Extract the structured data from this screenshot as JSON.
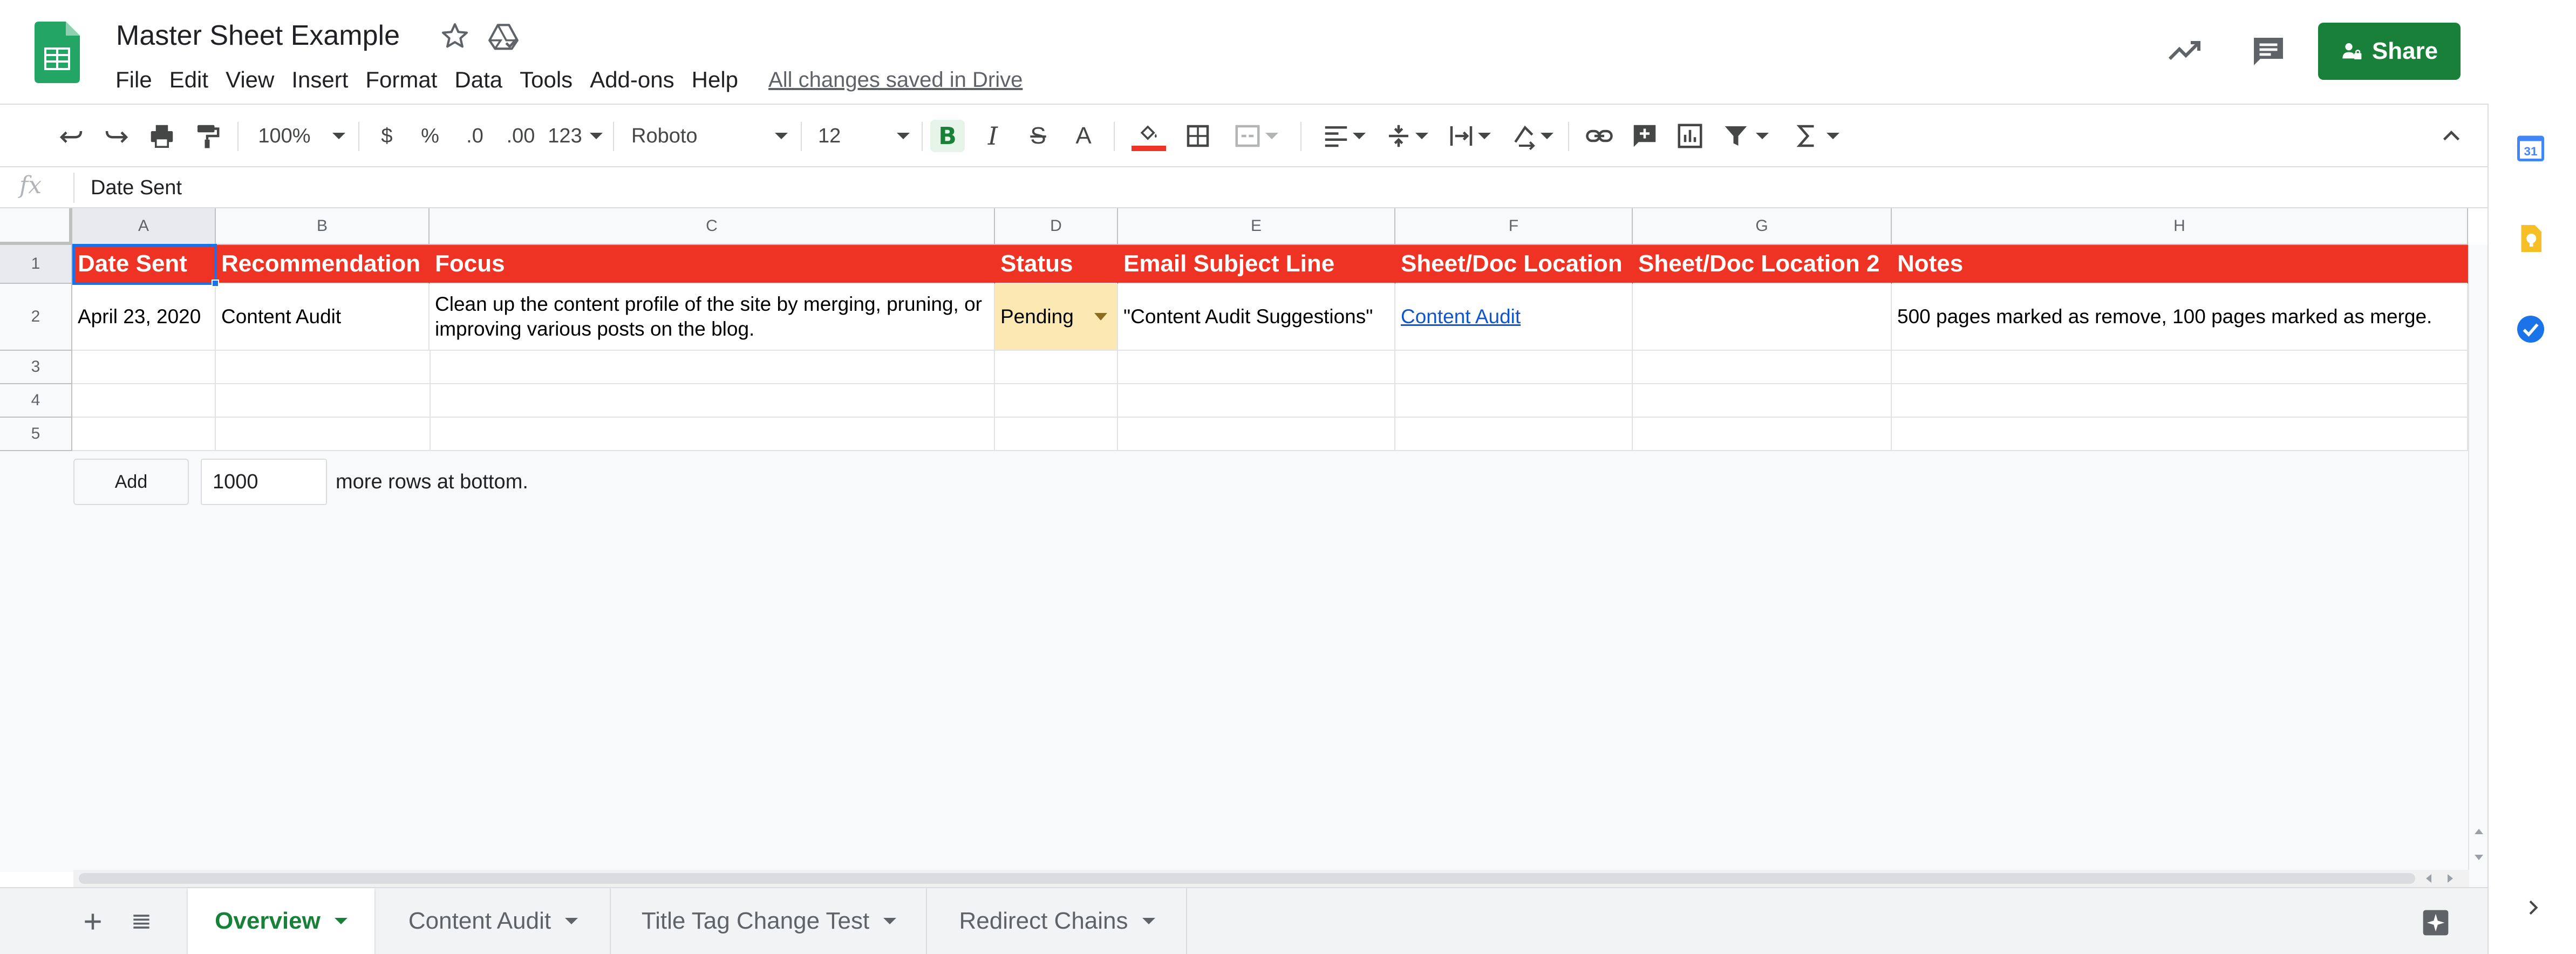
{
  "header": {
    "title": "Master Sheet Example",
    "save_status": "All changes saved in Drive",
    "share_label": "Share",
    "menu": [
      "File",
      "Edit",
      "View",
      "Insert",
      "Format",
      "Data",
      "Tools",
      "Add-ons",
      "Help"
    ]
  },
  "toolbar": {
    "zoom": "100%",
    "currency": "$",
    "percent": "%",
    "decrease_decimal": ".0",
    "increase_decimal": ".00",
    "more_formats": "123",
    "font": "Roboto",
    "font_size": "12",
    "bold": "B",
    "italic": "I",
    "strikethrough": "S",
    "text_color": "A"
  },
  "formula_bar": {
    "fx": "fx",
    "value": "Date Sent"
  },
  "grid": {
    "columns": [
      "A",
      "B",
      "C",
      "D",
      "E",
      "F",
      "G",
      "H"
    ],
    "rows": [
      "1",
      "2",
      "3",
      "4",
      "5"
    ],
    "header_row": [
      "Date Sent",
      "Recommendation",
      "Focus",
      "Status",
      "Email Subject Line",
      "Sheet/Doc Location",
      "Sheet/Doc Location 2",
      "Notes"
    ],
    "data_row": {
      "date_sent": "April 23, 2020",
      "recommendation": "Content Audit",
      "focus": "Clean up the content profile of the site by merging, pruning, or improving various posts on the blog.",
      "status": "Pending",
      "email_subject": "\"Content Audit Suggestions\"",
      "location": "Content Audit",
      "location_2": "",
      "notes": "500 pages marked as remove, 100 pages marked as merge."
    },
    "add_rows": {
      "button": "Add",
      "count": "1000",
      "label": "more rows at bottom."
    }
  },
  "sheets": {
    "tabs": [
      "Overview",
      "Content Audit",
      "Title Tag Change Test",
      "Redirect Chains"
    ],
    "active": "Overview"
  },
  "colors": {
    "brand_green": "#188038",
    "header_red": "#ee3224",
    "selection_blue": "#1a73e8",
    "status_yellow": "#fce8b2",
    "link_blue": "#1155cc"
  },
  "icons": {
    "app_logo": "sheets-logo-icon",
    "star": "star-icon",
    "drive": "drive-status-icon",
    "activity": "activity-trend-icon",
    "comments": "comments-icon",
    "calendar": "calendar-icon",
    "keep": "keep-icon",
    "tasks": "tasks-icon",
    "explore": "explore-icon"
  },
  "side_panel": {
    "calendar_day": "31"
  }
}
